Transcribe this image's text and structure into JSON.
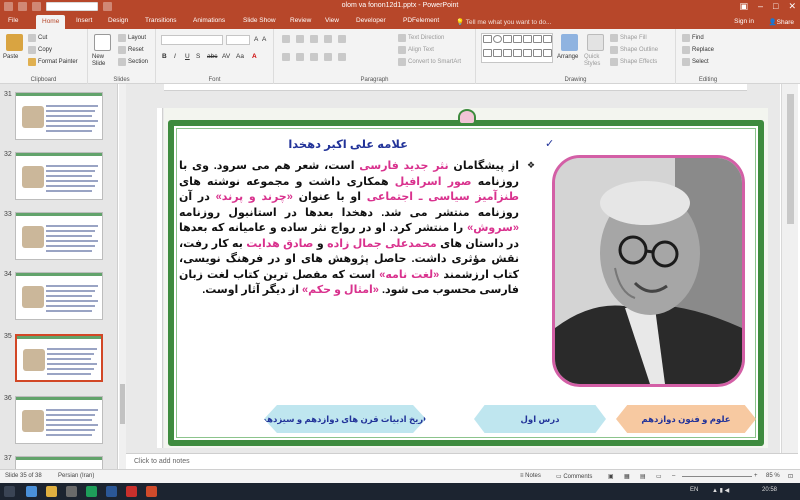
{
  "window": {
    "title": "olom va fonon12d1.pptx - PowerPoint"
  },
  "tabs": [
    {
      "label": "File",
      "active": false
    },
    {
      "label": "Home",
      "active": true
    },
    {
      "label": "Insert",
      "active": false
    },
    {
      "label": "Design",
      "active": false
    },
    {
      "label": "Transitions",
      "active": false
    },
    {
      "label": "Animations",
      "active": false
    },
    {
      "label": "Slide Show",
      "active": false
    },
    {
      "label": "Review",
      "active": false
    },
    {
      "label": "View",
      "active": false
    },
    {
      "label": "Developer",
      "active": false
    },
    {
      "label": "PDFelement",
      "active": false
    }
  ],
  "tellme": "Tell me what you want to do...",
  "signin": "Sign in",
  "share": "Share",
  "ribbon": {
    "clipboard": {
      "paste": "Paste",
      "cut": "Cut",
      "copy": "Copy",
      "format_painter": "Format Painter",
      "label": "Clipboard"
    },
    "slides": {
      "new_slide": "New Slide",
      "layout": "Layout",
      "reset": "Reset",
      "section": "Section",
      "label": "Slides"
    },
    "font": {
      "label": "Font",
      "formats": [
        "B",
        "I",
        "U",
        "S",
        "abc",
        "AV",
        "Aa",
        "A"
      ]
    },
    "paragraph": {
      "text_direction": "Text Direction",
      "align_text": "Align Text",
      "convert_smartart": "Convert to SmartArt",
      "label": "Paragraph"
    },
    "drawing": {
      "arrange": "Arrange",
      "quick_styles": "Quick Styles",
      "shape_fill": "Shape Fill",
      "shape_outline": "Shape Outline",
      "shape_effects": "Shape Effects",
      "label": "Drawing"
    },
    "editing": {
      "find": "Find",
      "replace": "Replace",
      "select": "Select",
      "label": "Editing"
    }
  },
  "thumbnails": [
    {
      "num": "31",
      "selected": false
    },
    {
      "num": "32",
      "selected": false
    },
    {
      "num": "33",
      "selected": false
    },
    {
      "num": "34",
      "selected": false
    },
    {
      "num": "35",
      "selected": true
    },
    {
      "num": "36",
      "selected": false
    },
    {
      "num": "37",
      "selected": false
    }
  ],
  "slide": {
    "heading": "علامه علی اکبر دهخدا",
    "body": [
      {
        "t": "از پیشگامان ",
        "hl": false
      },
      {
        "t": "نثر جدید فارسی",
        "hl": true
      },
      {
        "t": " است، شعر هم می سرود. وی با روزنامه ",
        "hl": false
      },
      {
        "t": "صور اسرافیل",
        "hl": true
      },
      {
        "t": " همکاری داشت و مجموعه نوشته های ",
        "hl": false
      },
      {
        "t": "طنزآمیز سیاسی ـ اجتماعی",
        "hl": true
      },
      {
        "t": " او با عنوان ",
        "hl": false
      },
      {
        "t": "«چرند و پرند»",
        "hl": true
      },
      {
        "t": " در آن روزنامه منتشر می شد. دهخدا بعدها در استانبول روزنامه ",
        "hl": false
      },
      {
        "t": "«سروش»",
        "hl": true
      },
      {
        "t": " را منتشر کرد. او در رواج نثر ساده و عامیانه که بعدها در داستان های ",
        "hl": false
      },
      {
        "t": "محمدعلی جمال زاده",
        "hl": true
      },
      {
        "t": " و ",
        "hl": false
      },
      {
        "t": "صادق هدایت",
        "hl": true
      },
      {
        "t": " به کار رفت، نقش مؤثری داشت. حاصل پژوهش های او در فرهنگ نویسی، کتاب ارزشمند ",
        "hl": false
      },
      {
        "t": "«لغت نامه»",
        "hl": true
      },
      {
        "t": " است که مفصل ترین کتاب لغت زبان فارسی محسوب می شود. ",
        "hl": false
      },
      {
        "t": "«امثال و حکم»",
        "hl": true
      },
      {
        "t": " از دیگر آثار اوست.",
        "hl": false
      }
    ],
    "buttons": {
      "b1": "تاریخ ادبیات قرن های دوازدهم و سیزدهم",
      "b2": "درس اول",
      "b3": "علوم و فنون دوازدهم"
    }
  },
  "notes_placeholder": "Click to add notes",
  "status": {
    "slide_info": "Slide 35 of 38",
    "language": "Persian (Iran)",
    "notes": "Notes",
    "comments": "Comments",
    "zoom": "85 %"
  },
  "taskbar": {
    "lang": "EN",
    "time": "20:58"
  },
  "colors": {
    "accent": "#b7472a",
    "frame": "#3e8b3e",
    "highlight": "#d9328e",
    "heading": "#223399",
    "photo_border": "#d35fa6"
  }
}
